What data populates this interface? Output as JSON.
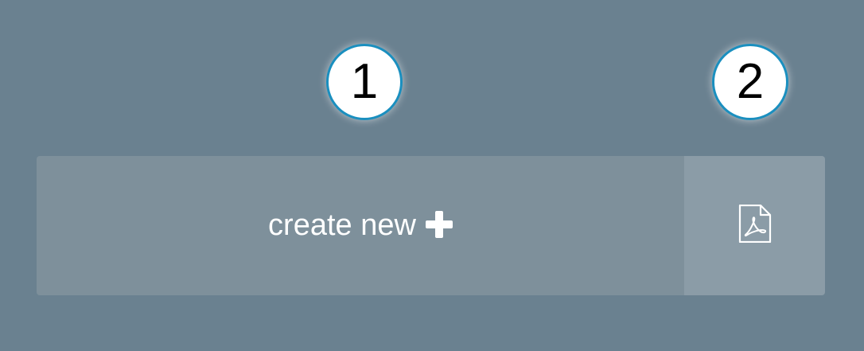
{
  "callouts": [
    {
      "label": "1"
    },
    {
      "label": "2"
    }
  ],
  "toolbar": {
    "create_label": "create new",
    "create_icon": "plus-icon",
    "pdf_icon": "pdf-file-icon"
  },
  "colors": {
    "background": "#6a8190",
    "create_button_bg": "#7e909b",
    "pdf_button_bg": "#8b9ca7",
    "callout_border": "#1a8fbf"
  }
}
